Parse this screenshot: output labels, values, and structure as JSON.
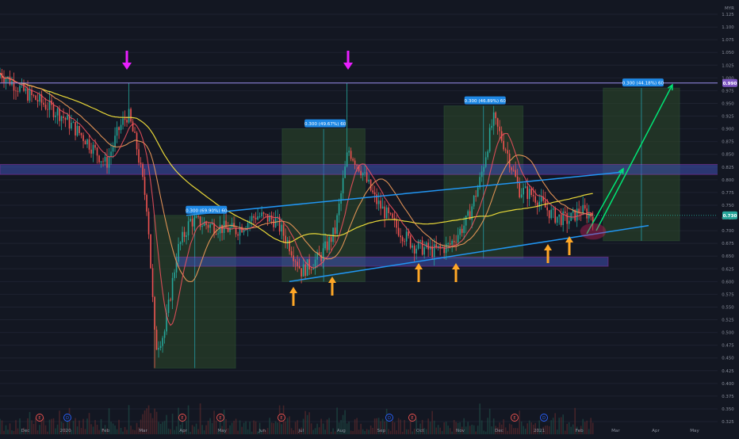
{
  "currency": "MYR",
  "price_axis": {
    "ticks": [
      "1.125",
      "1.100",
      "1.075",
      "1.050",
      "1.025",
      "1.000",
      "0.975",
      "0.950",
      "0.925",
      "0.900",
      "0.875",
      "0.850",
      "0.825",
      "0.800",
      "0.775",
      "0.750",
      "0.725",
      "0.700",
      "0.675",
      "0.650",
      "0.625",
      "0.600",
      "0.575",
      "0.550",
      "0.525",
      "0.500",
      "0.475",
      "0.450",
      "0.425",
      "0.400",
      "0.375",
      "0.350",
      "0.325"
    ],
    "current_price_label": "0.730",
    "resistance_price_label": "0.990"
  },
  "time_axis": {
    "labels": [
      "Dec",
      "2020",
      "Feb",
      "Mar",
      "Apr",
      "May",
      "Jun",
      "Jul",
      "Aug",
      "Sep",
      "Oct",
      "Nov",
      "Dec",
      "2021",
      "Feb",
      "Mar",
      "Apr",
      "May"
    ]
  },
  "measure_labels": [
    "0.300 (69.90%) 60",
    "0.300 (49.67%) 60",
    "0.300 (46.89%) 60",
    "0.300 (44.18%) 60"
  ],
  "event_markers": [
    "E",
    "D",
    "E",
    "E",
    "E",
    "D",
    "E",
    "E",
    "D"
  ],
  "colors": {
    "background": "#131722",
    "candle_up": "#26a69a",
    "candle_down": "#ef5350",
    "ma_fast": "#f7525f",
    "ma_slow": "#ffeb3b",
    "trendline": "#2196f3",
    "zone_fill": "#3f51b5",
    "measure_box": "#1b5e20",
    "arrow_magenta": "#e91eff",
    "arrow_orange": "#ffa726",
    "arrow_green": "#00e676",
    "resistance_line": "#9c8ff0"
  },
  "chart_data": {
    "type": "candlestick",
    "symbol_currency": "MYR",
    "ylim": [
      0.31,
      1.14
    ],
    "x_range": [
      "2019-11-20",
      "2021-05-20"
    ],
    "months": [
      "2019-12",
      "2020-01",
      "2020-02",
      "2020-03",
      "2020-04",
      "2020-05",
      "2020-06",
      "2020-07",
      "2020-08",
      "2020-09",
      "2020-10",
      "2020-11",
      "2020-12",
      "2021-01",
      "2021-02"
    ],
    "close_approx": [
      0.99,
      0.93,
      0.85,
      0.55,
      0.7,
      0.7,
      0.72,
      0.64,
      0.86,
      0.72,
      0.66,
      0.72,
      0.88,
      0.75,
      0.73
    ],
    "last_price": 0.73,
    "resistance_level": 0.99,
    "measures": [
      {
        "label": "0.300 (69.90%) 60",
        "from": 0.43,
        "to": 0.73,
        "bars": 60
      },
      {
        "label": "0.300 (49.67%) 60",
        "from": 0.6,
        "to": 0.9,
        "bars": 60
      },
      {
        "label": "0.300 (46.89%) 60",
        "from": 0.645,
        "to": 0.945,
        "bars": 60
      },
      {
        "label": "0.300 (44.18%) 60",
        "from": 0.68,
        "to": 0.98,
        "bars": 60
      }
    ]
  }
}
